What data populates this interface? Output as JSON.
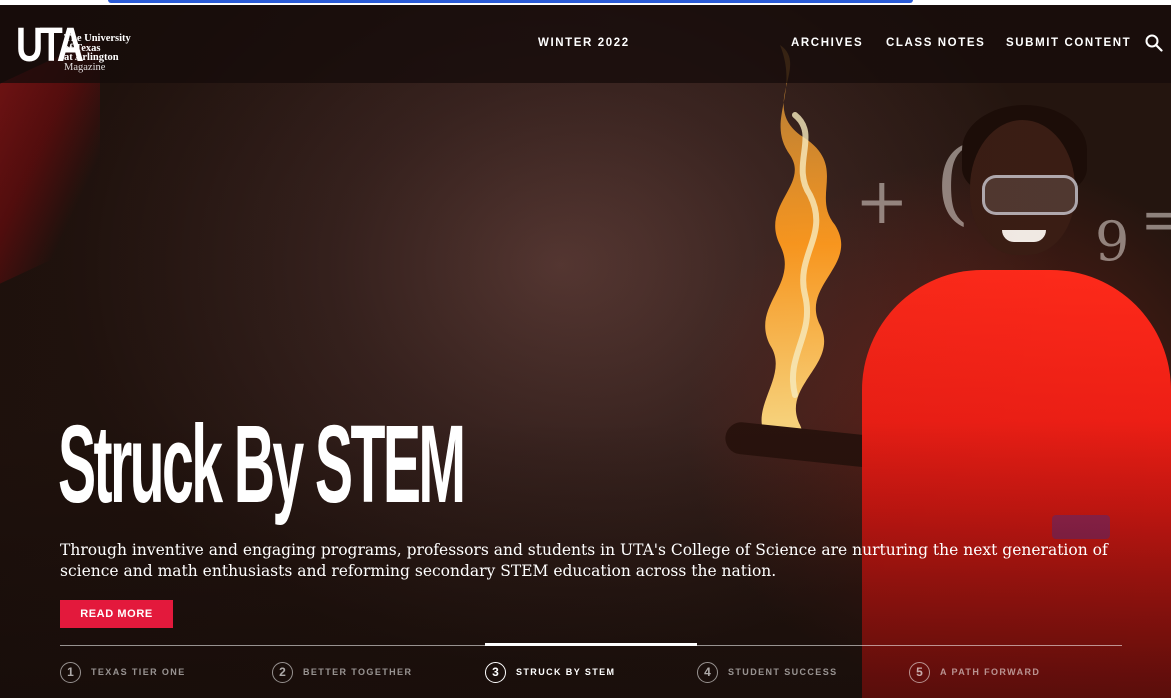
{
  "brand": {
    "mark": "UTA",
    "line1": "The University",
    "line2": "of Texas",
    "line3": "at Arlington",
    "line4": "Magazine"
  },
  "header": {
    "issue": "WINTER 2022",
    "nav": [
      "ARCHIVES",
      "CLASS NOTES",
      "SUBMIT CONTENT"
    ],
    "search_icon": "search-icon"
  },
  "hero": {
    "title": "Struck By STEM",
    "summary": "Through inventive and engaging programs, professors and students in UTA's College of Science are nurturing the next generation of science and math enthusiasts and reforming secondary STEM education across the nation.",
    "button": "READ MORE"
  },
  "stories": [
    {
      "num": "1",
      "label": "TEXAS TIER ONE",
      "active": false
    },
    {
      "num": "2",
      "label": "BETTER TOGETHER",
      "active": false
    },
    {
      "num": "3",
      "label": "STRUCK BY STEM",
      "active": true
    },
    {
      "num": "4",
      "label": "STUDENT SUCCESS",
      "active": false
    },
    {
      "num": "5",
      "label": "A PATH FORWARD",
      "active": false
    }
  ],
  "colors": {
    "accent": "#e3193c",
    "header_bg": "#160c0a",
    "shirt": "#e21812"
  }
}
